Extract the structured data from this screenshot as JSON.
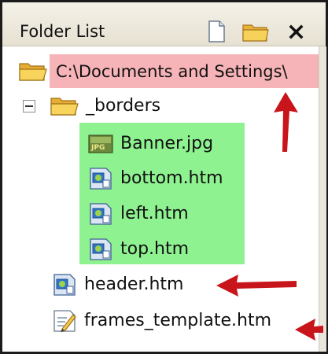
{
  "panel": {
    "title": "Folder List",
    "buttons": {
      "new_page": "new-page-icon",
      "new_folder": "new-folder-icon",
      "close": "close-icon"
    }
  },
  "tree": {
    "root": {
      "label": "C:\\Documents and Settings\\"
    },
    "folder": {
      "label": "_borders"
    },
    "borders_items": [
      {
        "label": "Banner.jpg",
        "icon": "jpg-file-icon"
      },
      {
        "label": "bottom.htm",
        "icon": "htm-file-icon"
      },
      {
        "label": "left.htm",
        "icon": "htm-file-icon"
      },
      {
        "label": "top.htm",
        "icon": "htm-file-icon"
      }
    ],
    "root_items": [
      {
        "label": "header.htm",
        "icon": "htm-file-icon"
      },
      {
        "label": "frames_template.htm",
        "icon": "edit-file-icon"
      }
    ]
  },
  "colors": {
    "root_highlight": "#f6b4b8",
    "group_highlight": "#8ff290",
    "annotation_arrow": "#c8151b"
  }
}
